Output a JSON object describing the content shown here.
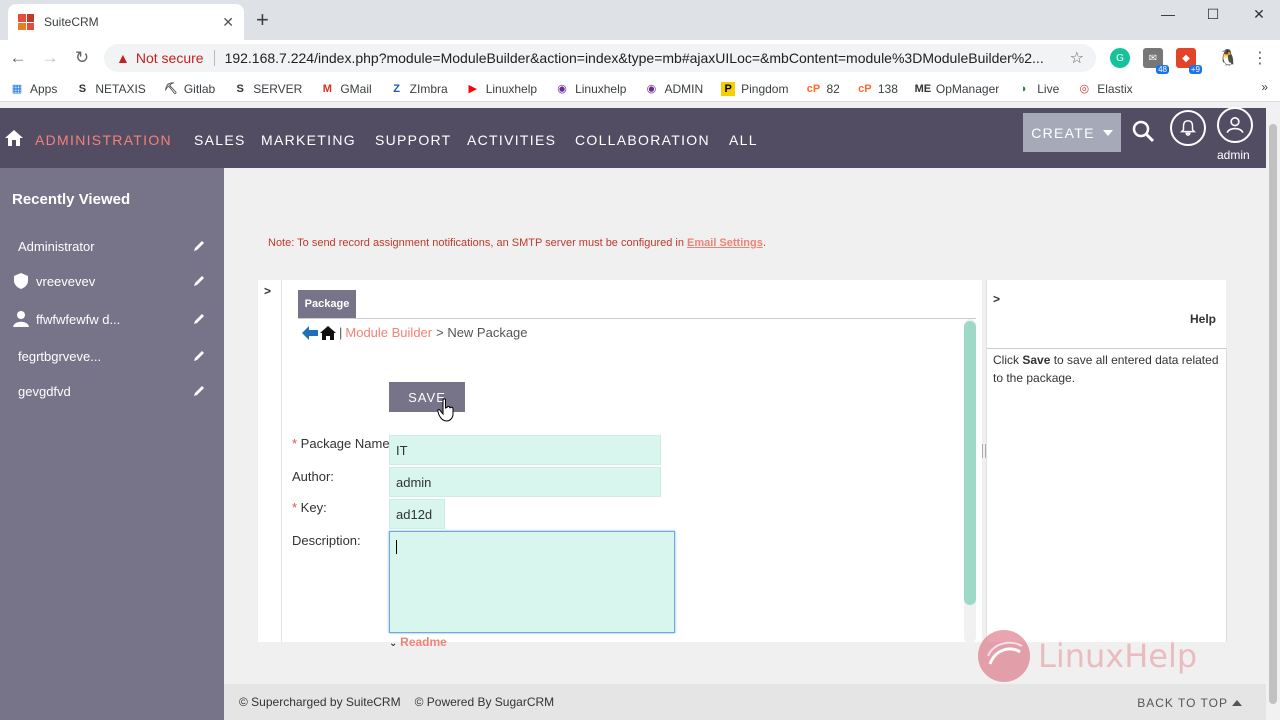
{
  "browser": {
    "tab_title": "SuiteCRM",
    "not_secure": "Not secure",
    "url": "192.168.7.224/index.php?module=ModuleBuilder&action=index&type=mb#ajaxUILoc=&mbContent=module%3DModuleBuilder%2...",
    "ext_badge_1": "48",
    "ext_badge_2": "+9"
  },
  "bookmarks": [
    {
      "label": "Apps",
      "icon": "apps-grid-icon",
      "color": "#1a73e8"
    },
    {
      "label": "NETAXIS",
      "icon": "s-icon",
      "color": "#333333"
    },
    {
      "label": "Gitlab",
      "icon": "gitlab-icon",
      "color": "#555555"
    },
    {
      "label": "SERVER",
      "icon": "s-icon",
      "color": "#333333"
    },
    {
      "label": "GMail",
      "icon": "gmail-icon",
      "color": "#d93025"
    },
    {
      "label": "ZImbra",
      "icon": "zimbra-icon",
      "color": "#1a5aa6"
    },
    {
      "label": "Linuxhelp",
      "icon": "youtube-icon",
      "color": "#ff0000"
    },
    {
      "label": "Linuxhelp",
      "icon": "linuxhelp-icon",
      "color": "#6a2c91"
    },
    {
      "label": "ADMIN",
      "icon": "admin-icon",
      "color": "#6a2c91"
    },
    {
      "label": "Pingdom",
      "icon": "pingdom-icon",
      "color": "#f5d000"
    },
    {
      "label": "82",
      "icon": "cpanel-icon",
      "color": "#ff6c2c"
    },
    {
      "label": "138",
      "icon": "cpanel-icon",
      "color": "#ff6c2c"
    },
    {
      "label": "OpManager",
      "icon": "opmanager-icon",
      "color": "#333333"
    },
    {
      "label": "Live",
      "icon": "live-icon",
      "color": "#2e7d32"
    },
    {
      "label": "Elastix",
      "icon": "elastix-icon",
      "color": "#d32f2f"
    }
  ],
  "nav": {
    "items": [
      "ADMINISTRATION",
      "SALES",
      "MARKETING",
      "SUPPORT",
      "ACTIVITIES",
      "COLLABORATION",
      "ALL"
    ],
    "create": "CREATE",
    "user": "admin",
    "accent": "#f08377",
    "bg": "#534d64"
  },
  "sidebar": {
    "title": "Recently Viewed",
    "items": [
      {
        "label": "Administrator",
        "icon": ""
      },
      {
        "label": "vreevevev",
        "icon": "shield-icon"
      },
      {
        "label": "ffwfwfewfw d...",
        "icon": "user-icon"
      },
      {
        "label": "fegrtbgrveve...",
        "icon": ""
      },
      {
        "label": "gevgdfvd",
        "icon": ""
      }
    ]
  },
  "main": {
    "note_text": "Note: To send record assignment notifications, an SMTP server must be configured in ",
    "note_link": "Email Settings",
    "note_end": ".",
    "package_tab": "Package",
    "breadcrumb_link": "Module Builder",
    "breadcrumb_current": "> New Package",
    "save": "SAVE",
    "fields": {
      "package_name_label": "Package Name:",
      "package_name_value": "IT",
      "author_label": "Author:",
      "author_value": "admin",
      "key_label": "Key:",
      "key_value": "ad12d",
      "description_label": "Description:",
      "description_value": ""
    },
    "readme": "Readme"
  },
  "help": {
    "title": "Help",
    "text_pre": "Click ",
    "text_bold": "Save",
    "text_post": " to save all entered data related to the package."
  },
  "watermark": "LinuxHelp",
  "footer": {
    "supercharged": "© Supercharged by SuiteCRM",
    "powered": "© Powered By SugarCRM",
    "back_to_top": "BACK TO TOP"
  }
}
